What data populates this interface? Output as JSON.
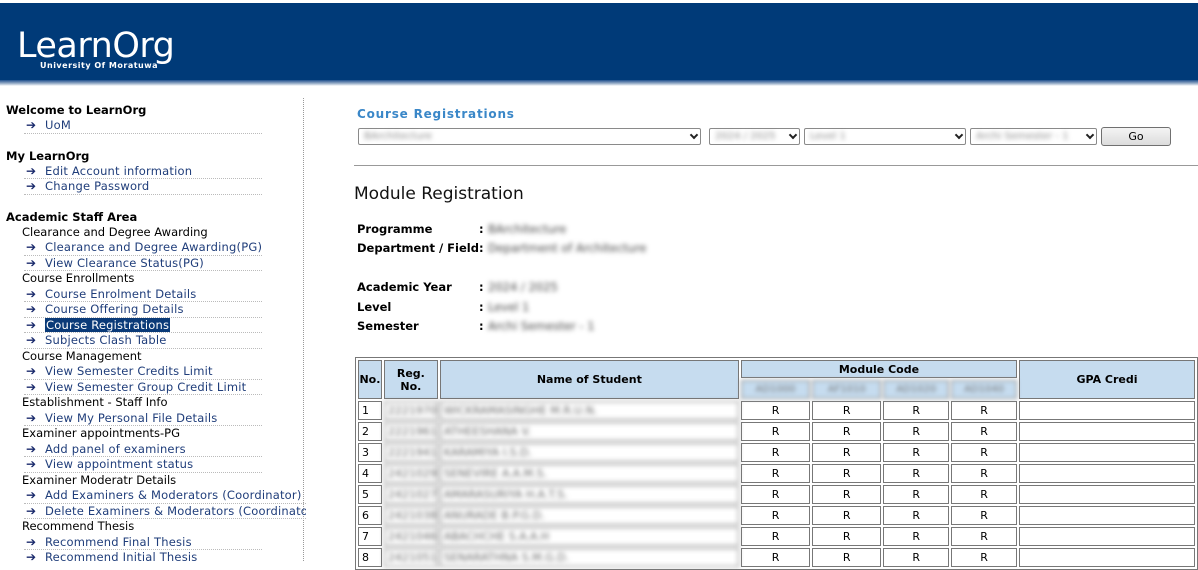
{
  "header": {
    "logo_text": "LearnOrg",
    "logo_subtitle": "University Of Moratuwa"
  },
  "sidebar": {
    "welcome": {
      "title": "Welcome to LearnOrg",
      "links": [
        "UoM"
      ]
    },
    "my_learnorg": {
      "title": "My LearnOrg",
      "links": [
        "Edit Account information",
        "Change Password"
      ]
    },
    "academic": {
      "title": "Academic Staff Area",
      "categories": [
        {
          "name": "Clearance and Degree Awarding",
          "links": [
            "Clearance and Degree Awarding(PG)",
            "View Clearance Status(PG)"
          ]
        },
        {
          "name": "Course Enrollments",
          "links": [
            "Course Enrolment Details",
            "Course Offering Details",
            "Course Registrations",
            "Subjects Clash Table"
          ]
        },
        {
          "name": "Course Management",
          "links": [
            "View Semester Credits Limit",
            "View Semester Group Credit Limit"
          ]
        },
        {
          "name": "Establishment - Staff Info",
          "links": [
            "View My Personal File Details"
          ]
        },
        {
          "name": "Examiner appointments-PG",
          "links": [
            "Add panel of examiners",
            "View appointment status"
          ]
        },
        {
          "name": "Examiner Moderatr Details",
          "links": [
            "Add Examiners & Moderators (Coordinator)",
            "Delete Examiners & Moderators (Coordinator)"
          ]
        },
        {
          "name": "Recommend Thesis",
          "links": [
            "Recommend Final Thesis",
            "Recommend Initial Thesis"
          ]
        }
      ]
    }
  },
  "main": {
    "section_title": "Course Registrations",
    "filters": {
      "programme": "BArchitecture",
      "year": "2024 / 2025",
      "level": "Level 1",
      "semester": "Archi Semester - 1"
    },
    "go_label": "Go",
    "heading": "Module Registration",
    "info": {
      "programme_label": "Programme",
      "programme_value": "BArchitecture",
      "department_label": "Department / Field",
      "department_value": "Department of Architecture",
      "year_label": "Academic Year",
      "year_value": "2024 / 2025",
      "level_label": "Level",
      "level_value": "Level 1",
      "semester_label": "Semester",
      "semester_value": "Archi Semester - 1",
      "colon": ":"
    },
    "table": {
      "headers": {
        "no": "No.",
        "reg_no": "Reg. No.",
        "name": "Name of Student",
        "module_code": "Module Code",
        "gpa": "GPA Credi"
      },
      "module_codes": [
        "AD1000",
        "AF1010",
        "AD1020",
        "AD1040"
      ],
      "rows": [
        {
          "no": "1",
          "reg": "2221970",
          "name": "WICKRAMASINGHE M.R.U.N.",
          "marks": [
            "R",
            "R",
            "R",
            "R"
          ],
          "gpa": ""
        },
        {
          "no": "2",
          "reg": "2221961",
          "name": "ATHEESHANA V.",
          "marks": [
            "R",
            "R",
            "R",
            "R"
          ],
          "gpa": ""
        },
        {
          "no": "3",
          "reg": "2221941",
          "name": "KARAMIYA I.S.D.",
          "marks": [
            "R",
            "R",
            "R",
            "R"
          ],
          "gpa": ""
        },
        {
          "no": "4",
          "reg": "2421029",
          "name": "SENEVIRE A.A.M.S.",
          "marks": [
            "R",
            "R",
            "R",
            "R"
          ],
          "gpa": ""
        },
        {
          "no": "5",
          "reg": "2421027",
          "name": "AMARASURIYA H.A.T.S.",
          "marks": [
            "R",
            "R",
            "R",
            "R"
          ],
          "gpa": ""
        },
        {
          "no": "6",
          "reg": "2421038",
          "name": "ANURADE B.P.G.D.",
          "marks": [
            "R",
            "R",
            "R",
            "R"
          ],
          "gpa": ""
        },
        {
          "no": "7",
          "reg": "2421046",
          "name": "ABACHCHE S.A.A.H",
          "marks": [
            "R",
            "R",
            "R",
            "R"
          ],
          "gpa": ""
        },
        {
          "no": "8",
          "reg": "2421051",
          "name": "SENARATHNA S.M.G.D.",
          "marks": [
            "R",
            "R",
            "R",
            "R"
          ],
          "gpa": ""
        }
      ]
    }
  }
}
